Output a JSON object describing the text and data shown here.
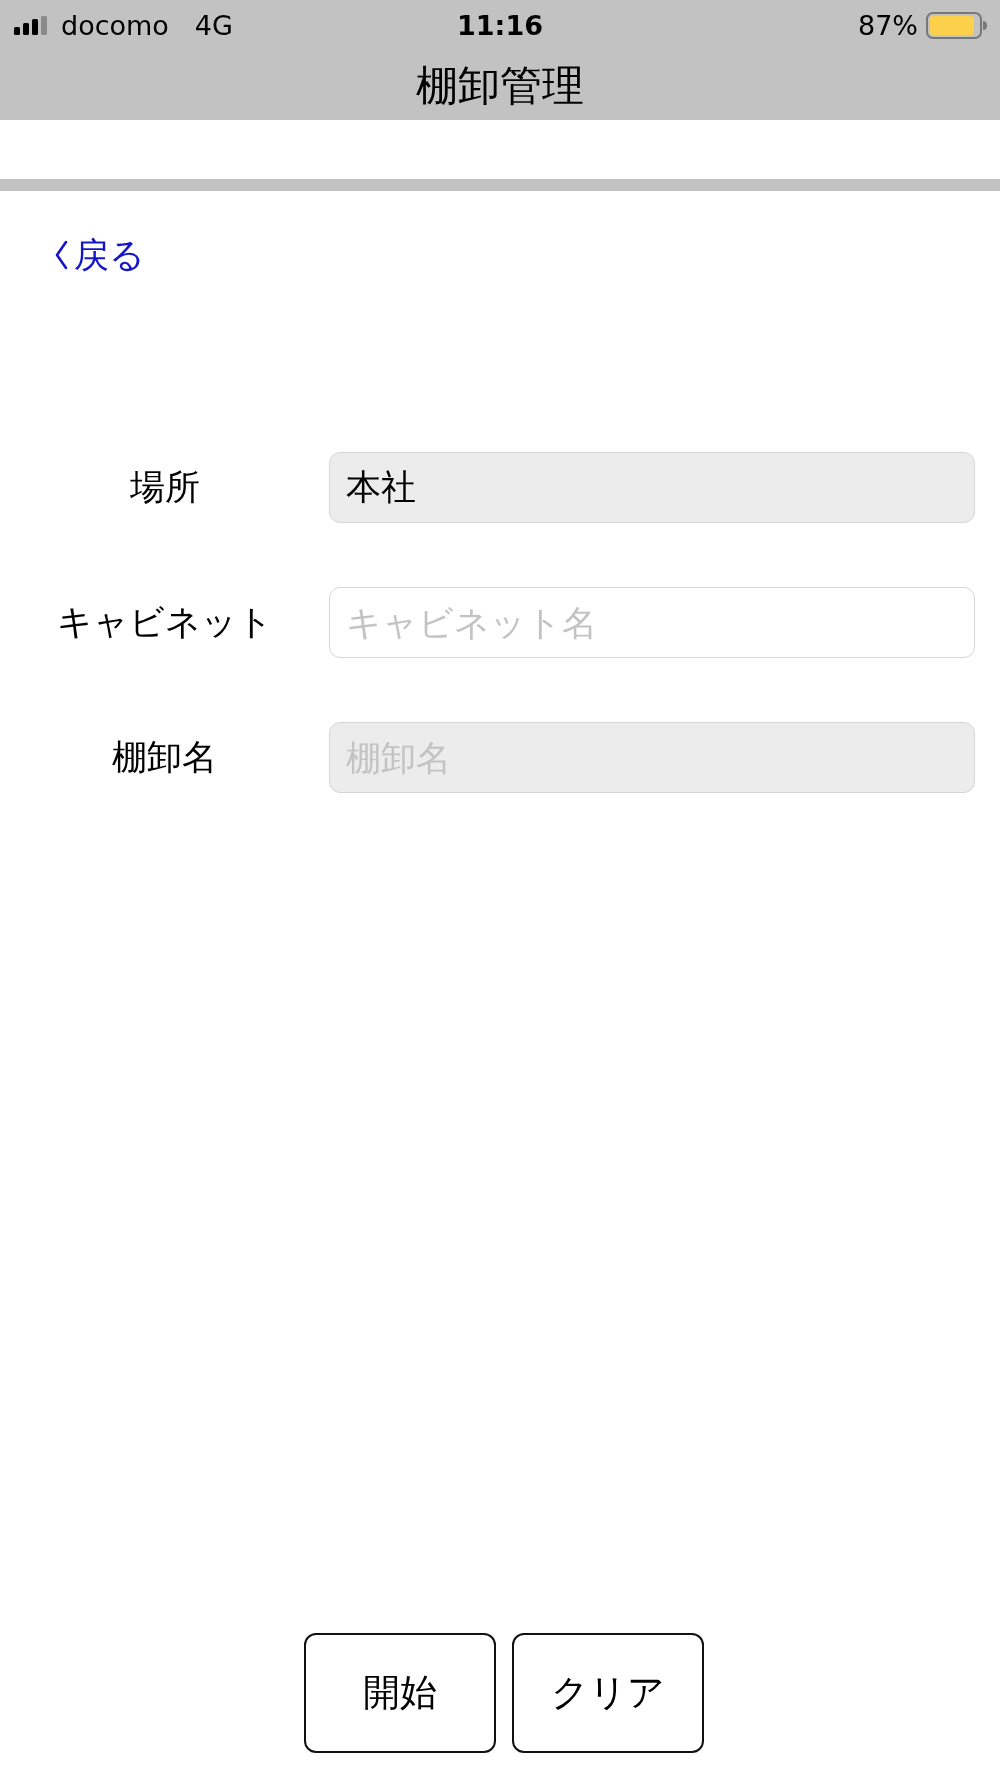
{
  "status_bar": {
    "carrier": "docomo",
    "network": "4G",
    "time": "11:16",
    "battery": "87%"
  },
  "nav_bar": {
    "title": "棚卸管理"
  },
  "back_link": {
    "label": "戻る"
  },
  "form": {
    "fields": [
      {
        "label": "場所",
        "value": "本社",
        "readonly": true
      },
      {
        "label": "キャビネット",
        "placeholder": "キャビネット名",
        "readonly": false
      },
      {
        "label": "棚卸名",
        "placeholder": "棚卸名",
        "readonly": true
      }
    ]
  },
  "buttons": [
    {
      "label": "開始"
    },
    {
      "label": "クリア"
    }
  ]
}
